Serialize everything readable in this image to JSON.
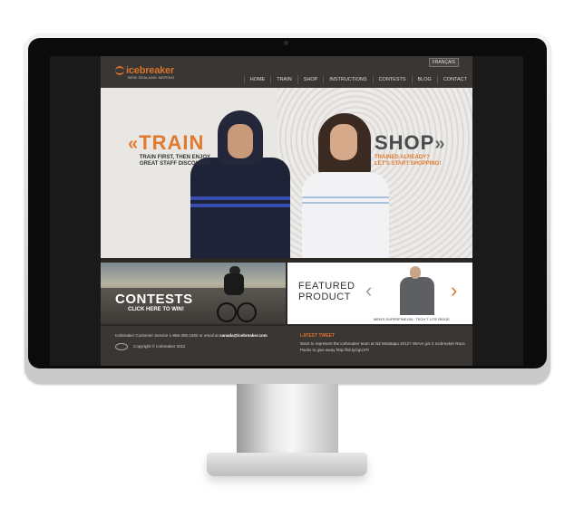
{
  "site": {
    "lang_button": "FRANÇAIS",
    "logo": "icebreaker",
    "tagline": "NEW ZEALAND MERINO",
    "nav": [
      "HOME",
      "TRAIN",
      "SHOP",
      "INSTRUCTIONS",
      "CONTESTS",
      "BLOG",
      "CONTACT"
    ]
  },
  "hero": {
    "train_title": "TRAIN",
    "train_sub_line1": "TRAIN FIRST, THEN ENJOY",
    "train_sub_line2": "GREAT STAFF DISCOUNTS",
    "shop_title": "SHOP",
    "shop_sub_line1": "TRAINED ALREADY?",
    "shop_sub_line2": "LET'S START SHOPPING!"
  },
  "contests": {
    "title": "CONTESTS",
    "subtitle": "CLICK HERE TO WIN!"
  },
  "featured": {
    "title_line1": "FEATURED",
    "title_line2": "PRODUCT",
    "caption": "MEN'S SUPERFINE150 : TECH T LITE RIDGE"
  },
  "footer": {
    "service": "Icebreaker Customer Service 1-866-395-1500 or email at",
    "email": "canada@icebreaker.com",
    "copyright": "Copyright © Icebreaker 2011",
    "tweet_heading": "LATEST TWEET",
    "tweet": "Want to represent the icebreaker team at NZ Motatapu 2012? We've got 2 Icebreaker Race Packs to give away http://bit.ly/zgU37t"
  },
  "colors": {
    "accent": "#d8742c",
    "header_bg": "#3a3633",
    "hero_bg": "#e9e7e4"
  }
}
